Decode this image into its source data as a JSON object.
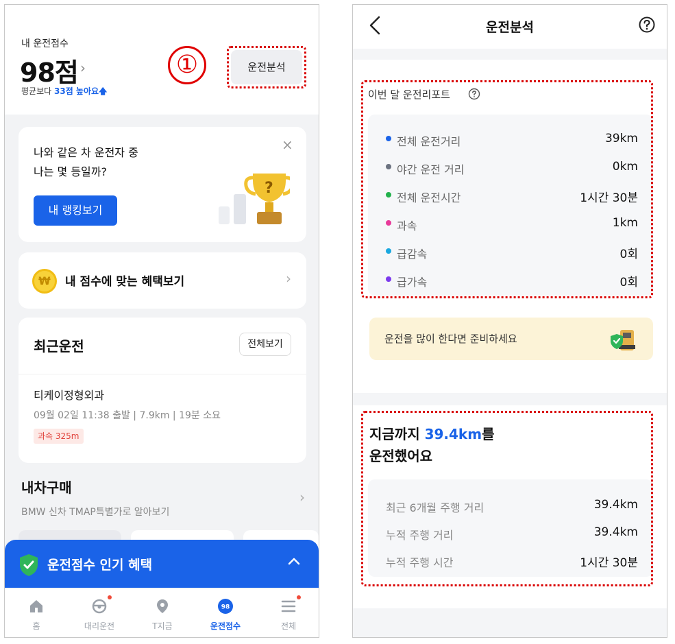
{
  "left": {
    "score": {
      "label": "내 운전점수",
      "value": "98점",
      "compare_prefix": "평균보다",
      "compare_value": "33점 높아요",
      "compare_arrow": "🡅",
      "chevron": "›"
    },
    "annotation_number": "①",
    "analysis_button": "운전분석",
    "ranking": {
      "text": "나와 같은 차 운전자 중\n나는 몇 등일까?",
      "button": "내 랭킹보기",
      "close": "×"
    },
    "benefit": {
      "coin": "₩",
      "label": "내 점수에 맞는 혜택보기"
    },
    "recent": {
      "title": "최근운전",
      "see_all": "전체보기",
      "place": "티케이정형외과",
      "meta": "09월 02일 11:38 출발 | 7.9km | 19분 소요",
      "badge": "과속 325m"
    },
    "car_buy": {
      "title": "내차구매",
      "subtitle": "BMW 신차 TMAP특별가로 알아보기"
    },
    "popular": {
      "label": "운전점수 인기 혜택"
    },
    "tabs": [
      {
        "label": "홈"
      },
      {
        "label": "대리운전"
      },
      {
        "label": "T지금"
      },
      {
        "label": "운전점수",
        "badge": "98"
      },
      {
        "label": "전체"
      }
    ]
  },
  "right": {
    "header": {
      "title": "운전분석"
    },
    "report": {
      "title": "이번 달 운전리포트",
      "rows": [
        {
          "label": "전체 운전거리",
          "value": "39km",
          "color": "#1a63e8"
        },
        {
          "label": "야간 운전 거리",
          "value": "0km",
          "color": "#6b7280"
        },
        {
          "label": "전체 운전시간",
          "value": "1시간 30분",
          "color": "#22b14c"
        },
        {
          "label": "과속",
          "value": "1km",
          "color": "#e8399a"
        },
        {
          "label": "급감속",
          "value": "0회",
          "color": "#1aa8e0"
        },
        {
          "label": "급가속",
          "value": "0회",
          "color": "#7c3aed"
        }
      ]
    },
    "tip": {
      "text": "운전을 많이 한다면 준비하세요"
    },
    "distance": {
      "line1_prefix": "지금까지",
      "line1_value": "39.4km",
      "line1_suffix": "를",
      "line2": "운전했어요",
      "rows": [
        {
          "label": "최근 6개월 주행 거리",
          "value": "39.4km"
        },
        {
          "label": "누적 주행 거리",
          "value": "39.4km"
        },
        {
          "label": "누적 주행 시간",
          "value": "1시간 30분"
        }
      ]
    }
  }
}
